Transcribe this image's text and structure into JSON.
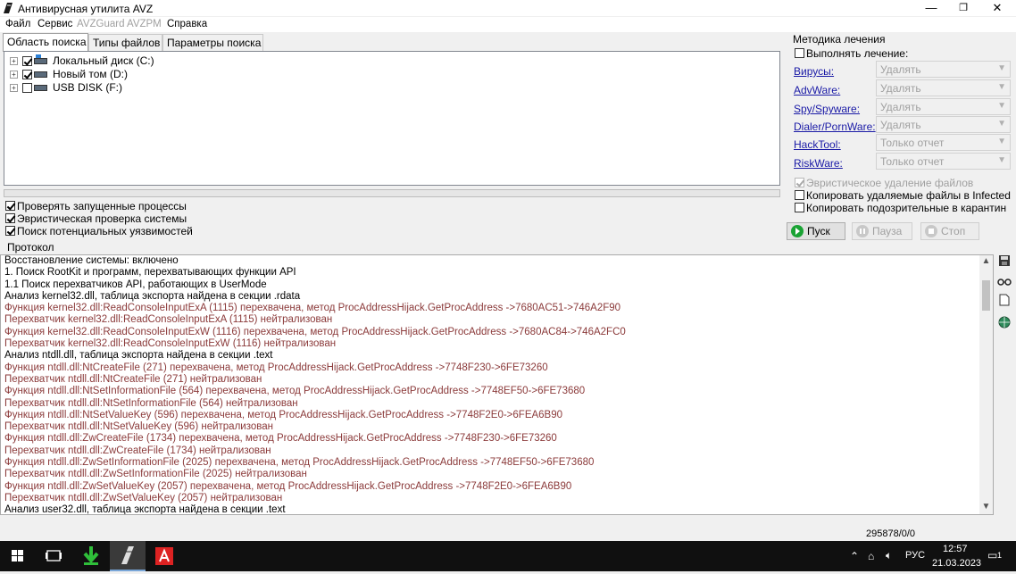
{
  "window": {
    "title": "Антивирусная утилита AVZ",
    "controls": [
      "—",
      "❐",
      "✕"
    ]
  },
  "menu": {
    "items": [
      {
        "label": "Файл",
        "enabled": true
      },
      {
        "label": "Сервис",
        "enabled": true
      },
      {
        "label": "AVZGuard",
        "enabled": false
      },
      {
        "label": "AVZPM",
        "enabled": false
      },
      {
        "label": "Справка",
        "enabled": true
      }
    ]
  },
  "tabs": [
    "Область поиска",
    "Типы файлов",
    "Параметры поиска"
  ],
  "drives": [
    {
      "label": "Локальный диск (C:)",
      "checked": true,
      "icon": "system-drive-icon"
    },
    {
      "label": "Новый том (D:)",
      "checked": true,
      "icon": "drive-icon"
    },
    {
      "label": "USB DISK (F:)",
      "checked": false,
      "icon": "usb-drive-icon"
    }
  ],
  "search_options": [
    {
      "label": "Проверять запущенные процессы",
      "checked": true
    },
    {
      "label": "Эвристическая проверка системы",
      "checked": true
    },
    {
      "label": "Поиск потенциальных уязвимостей",
      "checked": true
    }
  ],
  "treatment": {
    "title": "Методика лечения",
    "perform_label": "Выполнять лечение:",
    "perform_checked": false,
    "rows": [
      {
        "label": "Вирусы:",
        "value": "Удалять"
      },
      {
        "label": "AdvWare:",
        "value": "Удалять"
      },
      {
        "label": "Spy/Spyware:",
        "value": "Удалять"
      },
      {
        "label": "Dialer/PornWare:",
        "value": "Удалять"
      },
      {
        "label": "HackTool:",
        "value": "Только отчет"
      },
      {
        "label": "RiskWare:",
        "value": "Только отчет"
      }
    ],
    "heuristic_delete": "Эвристическое удаление файлов",
    "copy_deleted": "Копировать удаляемые файлы в  Infected",
    "copy_suspicious": "Копировать подозрительные в  карантин"
  },
  "buttons": {
    "start": "Пуск",
    "pause": "Пауза",
    "stop": "Стоп"
  },
  "protocol": {
    "title": "Протокол",
    "lines": [
      {
        "text": "Восстановление системы: включено",
        "color": "normal"
      },
      {
        "text": "1. Поиск RootKit и программ, перехватывающих функции API",
        "color": "normal"
      },
      {
        "text": "1.1 Поиск перехватчиков API, работающих в UserMode",
        "color": "normal"
      },
      {
        "text": " Анализ kernel32.dll, таблица экспорта найдена в секции .rdata",
        "color": "normal"
      },
      {
        "text": "Функция kernel32.dll:ReadConsoleInputExA (1115) перехвачена, метод ProcAddressHijack.GetProcAddress ->7680AC51->746A2F90",
        "color": "red"
      },
      {
        "text": "Перехватчик kernel32.dll:ReadConsoleInputExA (1115) нейтрализован",
        "color": "red"
      },
      {
        "text": "Функция kernel32.dll:ReadConsoleInputExW (1116) перехвачена, метод ProcAddressHijack.GetProcAddress ->7680AC84->746A2FC0",
        "color": "red"
      },
      {
        "text": "Перехватчик kernel32.dll:ReadConsoleInputExW (1116) нейтрализован",
        "color": "red"
      },
      {
        "text": " Анализ ntdll.dll, таблица экспорта найдена в секции .text",
        "color": "normal"
      },
      {
        "text": "Функция ntdll.dll:NtCreateFile (271) перехвачена, метод ProcAddressHijack.GetProcAddress ->7748F230->6FE73260",
        "color": "red"
      },
      {
        "text": "Перехватчик ntdll.dll:NtCreateFile (271) нейтрализован",
        "color": "red"
      },
      {
        "text": "Функция ntdll.dll:NtSetInformationFile (564) перехвачена, метод ProcAddressHijack.GetProcAddress ->7748EF50->6FE73680",
        "color": "red"
      },
      {
        "text": "Перехватчик ntdll.dll:NtSetInformationFile (564) нейтрализован",
        "color": "red"
      },
      {
        "text": "Функция ntdll.dll:NtSetValueKey (596) перехвачена, метод ProcAddressHijack.GetProcAddress ->7748F2E0->6FEA6B90",
        "color": "red"
      },
      {
        "text": "Перехватчик ntdll.dll:NtSetValueKey (596) нейтрализован",
        "color": "red"
      },
      {
        "text": "Функция ntdll.dll:ZwCreateFile (1734) перехвачена, метод ProcAddressHijack.GetProcAddress ->7748F230->6FE73260",
        "color": "red"
      },
      {
        "text": "Перехватчик ntdll.dll:ZwCreateFile (1734) нейтрализован",
        "color": "red"
      },
      {
        "text": "Функция ntdll.dll:ZwSetInformationFile (2025) перехвачена, метод ProcAddressHijack.GetProcAddress ->7748EF50->6FE73680",
        "color": "red"
      },
      {
        "text": "Перехватчик ntdll.dll:ZwSetInformationFile (2025) нейтрализован",
        "color": "red"
      },
      {
        "text": "Функция ntdll.dll:ZwSetValueKey (2057) перехвачена, метод ProcAddressHijack.GetProcAddress ->7748F2E0->6FEA6B90",
        "color": "red"
      },
      {
        "text": "Перехватчик ntdll.dll:ZwSetValueKey (2057) нейтрализован",
        "color": "red"
      },
      {
        "text": " Анализ user32.dll, таблица экспорта найдена в секции .text",
        "color": "normal"
      }
    ]
  },
  "status": {
    "counter": "295878/0/0"
  },
  "taskbar": {
    "language": "РУС",
    "time": "12:57",
    "date": "21.03.2023",
    "notifications": "1"
  },
  "colors": {
    "log_red": "#8b3a3a",
    "link_blue": "#1a1aa6",
    "taskbar_bg": "#101010"
  }
}
